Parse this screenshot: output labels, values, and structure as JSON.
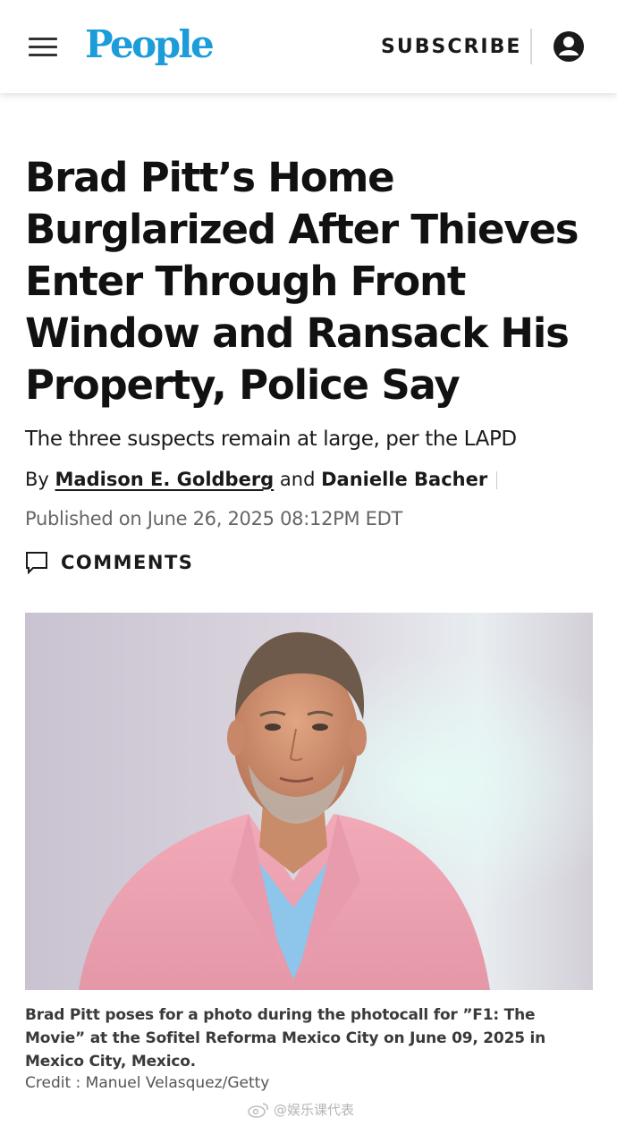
{
  "header": {
    "logo": "People",
    "subscribe_label": "SUBSCRIBE",
    "menu_icon": "hamburger-menu-icon",
    "account_icon": "account-icon",
    "brand_color": "#1c9cd9"
  },
  "article": {
    "headline": "Brad Pitt’s Home Burglarized After Thieves Enter Through Front Window and Ransack His Property, Police Say",
    "dek": "The three suspects remain at large, per the LAPD",
    "byline": {
      "prefix": "By",
      "author1": "Madison E. Goldberg",
      "conjunction": "and",
      "author2": "Danielle Bacher"
    },
    "published": "Published on June 26, 2025 08:12PM EDT",
    "comments_label": "COMMENTS",
    "comments_icon": "comment-bubble-icon"
  },
  "photo": {
    "caption": "Brad Pitt poses for a photo during the photocall for ”F1: The Movie” at the Sofitel Reforma Mexico City on June 09, 2025 in Mexico City, Mexico.",
    "credit": "Credit : Manuel Velasquez/Getty"
  },
  "watermark": {
    "text": "@娱乐课代表",
    "icon": "weibo-icon"
  }
}
